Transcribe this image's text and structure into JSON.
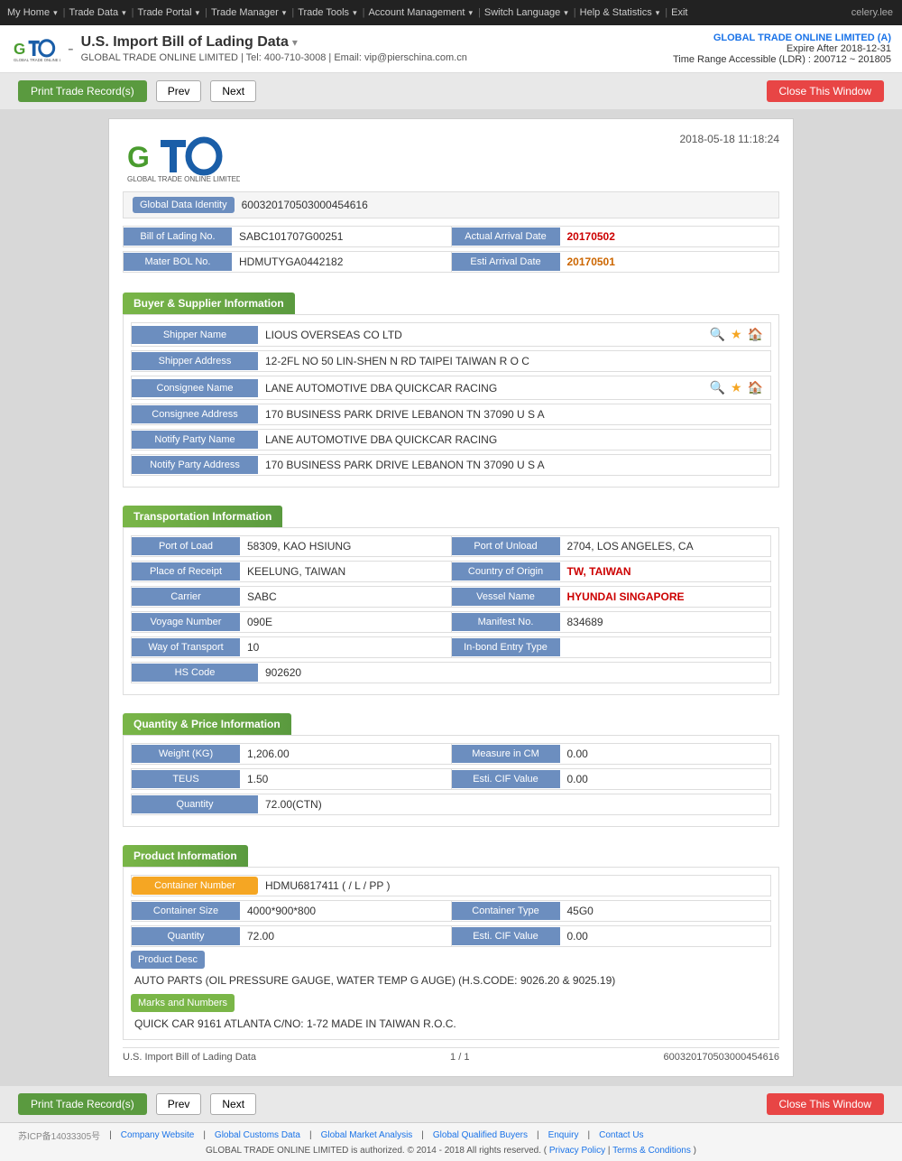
{
  "topnav": {
    "items": [
      {
        "label": "My Home",
        "arrow": "▾"
      },
      {
        "label": "Trade Data",
        "arrow": "▾"
      },
      {
        "label": "Trade Portal",
        "arrow": "▾"
      },
      {
        "label": "Trade Manager",
        "arrow": "▾"
      },
      {
        "label": "Trade Tools",
        "arrow": "▾"
      },
      {
        "label": "Account Management",
        "arrow": "▾"
      },
      {
        "label": "Switch Language",
        "arrow": "▾"
      },
      {
        "label": "Help & Statistics",
        "arrow": "▾"
      },
      {
        "label": "Exit"
      }
    ],
    "user": "celery.lee"
  },
  "header": {
    "title": "U.S. Import Bill of Lading Data",
    "title_arrow": "▾",
    "company": "GLOBAL TRADE ONLINE LIMITED",
    "tel": "Tel: 400-710-3008",
    "email": "Email: vip@pierschina.com.cn",
    "right_company": "GLOBAL TRADE ONLINE LIMITED (A)",
    "expire": "Expire After 2018-12-31",
    "ldr": "Time Range Accessible (LDR) : 200712 ~ 201805"
  },
  "toolbar": {
    "print_label": "Print Trade Record(s)",
    "prev_label": "Prev",
    "next_label": "Next",
    "close_label": "Close This Window"
  },
  "record": {
    "datetime": "2018-05-18 11:18:24",
    "global_data_identity_label": "Global Data Identity",
    "global_data_identity": "600320170503000454616",
    "bill_of_lading_no_label": "Bill of Lading No.",
    "bill_of_lading_no": "SABC101707G00251",
    "actual_arrival_date_label": "Actual Arrival Date",
    "actual_arrival_date": "20170502",
    "mater_bol_no_label": "Mater BOL No.",
    "mater_bol_no": "HDMUTYGA0442182",
    "esti_arrival_date_label": "Esti Arrival Date",
    "esti_arrival_date": "20170501",
    "buyer_supplier_header": "Buyer & Supplier Information",
    "shipper_name_label": "Shipper Name",
    "shipper_name": "LIOUS OVERSEAS CO LTD",
    "shipper_address_label": "Shipper Address",
    "shipper_address": "12-2FL NO 50 LIN-SHEN N RD TAIPEI TAIWAN R O C",
    "consignee_name_label": "Consignee Name",
    "consignee_name": "LANE AUTOMOTIVE DBA QUICKCAR RACING",
    "consignee_address_label": "Consignee Address",
    "consignee_address": "170 BUSINESS PARK DRIVE LEBANON TN 37090 U S A",
    "notify_party_name_label": "Notify Party Name",
    "notify_party_name": "LANE AUTOMOTIVE DBA QUICKCAR RACING",
    "notify_party_address_label": "Notify Party Address",
    "notify_party_address": "170 BUSINESS PARK DRIVE LEBANON TN 37090 U S A",
    "transportation_header": "Transportation Information",
    "port_of_load_label": "Port of Load",
    "port_of_load": "58309, KAO HSIUNG",
    "port_of_unload_label": "Port of Unload",
    "port_of_unload": "2704, LOS ANGELES, CA",
    "place_of_receipt_label": "Place of Receipt",
    "place_of_receipt": "KEELUNG, TAIWAN",
    "country_of_origin_label": "Country of Origin",
    "country_of_origin": "TW, TAIWAN",
    "carrier_label": "Carrier",
    "carrier": "SABC",
    "vessel_name_label": "Vessel Name",
    "vessel_name": "HYUNDAI SINGAPORE",
    "voyage_number_label": "Voyage Number",
    "voyage_number": "090E",
    "manifest_no_label": "Manifest No.",
    "manifest_no": "834689",
    "way_of_transport_label": "Way of Transport",
    "way_of_transport": "10",
    "inbond_entry_type_label": "In-bond Entry Type",
    "inbond_entry_type": "",
    "hs_code_label": "HS Code",
    "hs_code": "902620",
    "quantity_price_header": "Quantity & Price Information",
    "weight_label": "Weight (KG)",
    "weight": "1,206.00",
    "measure_in_cm_label": "Measure in CM",
    "measure_in_cm": "0.00",
    "teus_label": "TEUS",
    "teus": "1.50",
    "esti_cif_value_label": "Esti. CIF Value",
    "esti_cif_value": "0.00",
    "quantity_label": "Quantity",
    "quantity": "72.00(CTN)",
    "product_header": "Product Information",
    "container_number_label": "Container Number",
    "container_number": "HDMU6817411 ( / L / PP )",
    "container_size_label": "Container Size",
    "container_size": "4000*900*800",
    "container_type_label": "Container Type",
    "container_type": "45G0",
    "quantity2_label": "Quantity",
    "quantity2": "72.00",
    "esti_cif_value2_label": "Esti. CIF Value",
    "esti_cif_value2": "0.00",
    "product_desc_label": "Product Desc",
    "product_desc": "AUTO PARTS (OIL PRESSURE GAUGE, WATER TEMP G AUGE) (H.S.CODE: 9026.20 & 9025.19)",
    "marks_label": "Marks and Numbers",
    "marks_text": "QUICK CAR 9161 ATLANTA C/NO: 1-72 MADE IN TAIWAN R.O.C.",
    "footer_left": "U.S. Import Bill of Lading Data",
    "footer_page": "1 / 1",
    "footer_id": "600320170503000454616"
  },
  "bottom": {
    "icp": "苏ICP备14033305号",
    "links": [
      {
        "label": "Company Website"
      },
      {
        "label": "Global Customs Data"
      },
      {
        "label": "Global Market Analysis"
      },
      {
        "label": "Global Qualified Buyers"
      },
      {
        "label": "Enquiry"
      },
      {
        "label": "Contact Us"
      }
    ],
    "copyright": "GLOBAL TRADE ONLINE LIMITED is authorized. © 2014 - 2018 All rights reserved.",
    "privacy": "Privacy Policy",
    "terms": "Terms & Conditions"
  }
}
